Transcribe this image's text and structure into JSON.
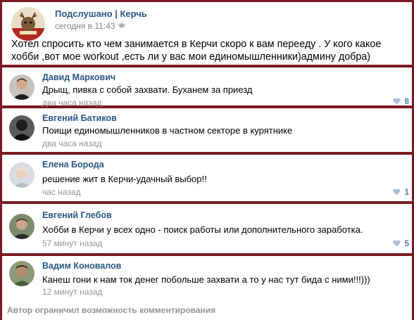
{
  "post": {
    "author": "Подслушано | Керчь",
    "time": "сегодня в 11:43",
    "text": "Хотел спросить кто чем занимается в Керчи скоро к вам переедy . У кого какое хобби ,вот мое workout ,есть ли у вас мои единомышленники)админу добра)"
  },
  "comments": [
    {
      "author": "Давид Маркович",
      "text": "Дрыщ, пивка с собой захвати. Буханем за приезд",
      "time": "два часа назад",
      "likes": "8"
    },
    {
      "author": "Евгений Батиков",
      "text": "Поищи единомышленников в частном секторе в курятнике",
      "time": "два часа назад"
    },
    {
      "author": "Елена Борода",
      "text": "решение жит в Керчи-удачный выбор!!",
      "time": "час назад",
      "likes": "1"
    },
    {
      "author": "Евгений Глебов",
      "text": "Хобби в Керчи у всех одно - поиск работы или дополнительного заработка.",
      "time": "57 минут назад",
      "likes": "5"
    },
    {
      "author": "Вадим Коновалов",
      "text": "Канеш гони к нам ток денег побольше захвати а то у нас тут бида с ними!!!)))",
      "time": "12 минут назад"
    }
  ],
  "footer": {
    "restricted": "Автор ограничил возможность комментирования"
  },
  "colors": {
    "frame": "#7a1a24",
    "link": "#2a5885",
    "muted": "#939393",
    "like": "#5b7fa6"
  },
  "icons": {
    "post_device": "android-icon",
    "like": "heart-icon"
  }
}
